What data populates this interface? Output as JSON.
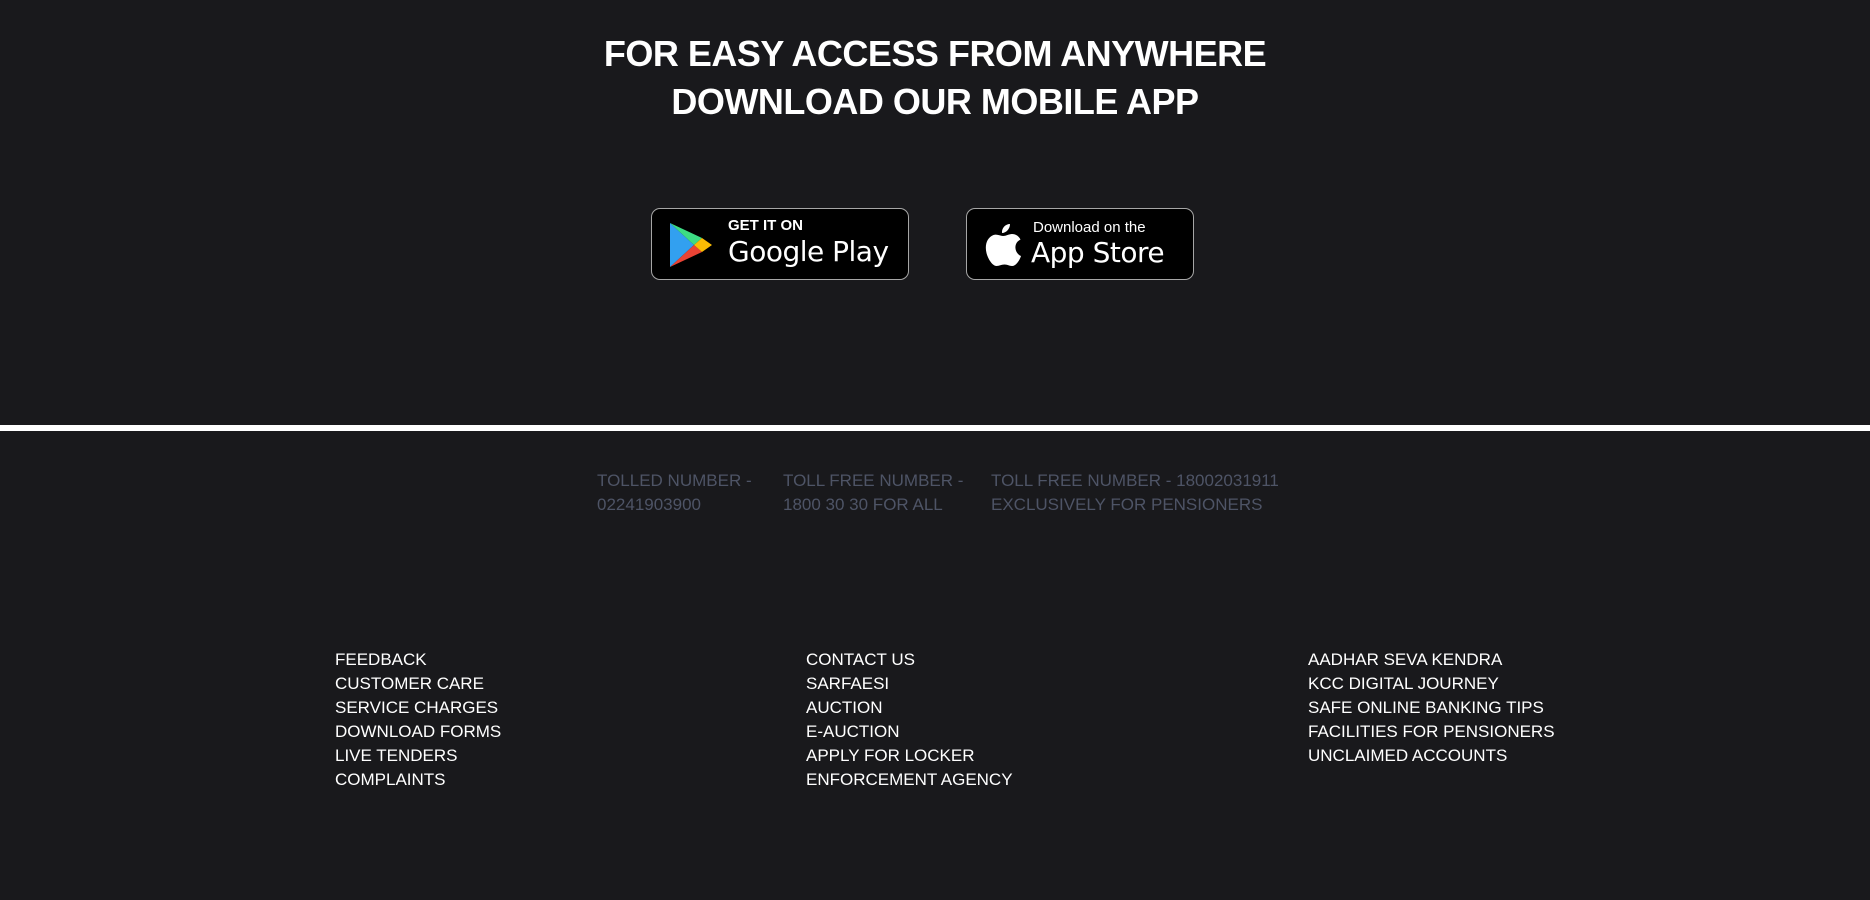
{
  "app_promo": {
    "heading_line1": "FOR EASY ACCESS FROM ANYWHERE",
    "heading_line2": "DOWNLOAD OUR MOBILE APP",
    "google_play": {
      "small": "GET IT ON",
      "big": "Google Play",
      "icon": "google-play-icon"
    },
    "app_store": {
      "small": "Download on the",
      "big": "App Store",
      "icon": "apple-icon"
    }
  },
  "contact_numbers": [
    {
      "line1": "TOLLED NUMBER -",
      "line2": "02241903900"
    },
    {
      "line1": "TOLL FREE NUMBER -",
      "line2": "1800 30 30 FOR ALL"
    },
    {
      "line1": "TOLL FREE NUMBER - 18002031911",
      "line2": "EXCLUSIVELY FOR PENSIONERS"
    }
  ],
  "footer_links": {
    "column1": [
      "FEEDBACK",
      "CUSTOMER CARE",
      "SERVICE CHARGES",
      "DOWNLOAD FORMS",
      "LIVE TENDERS",
      "COMPLAINTS"
    ],
    "column2": [
      "CONTACT US",
      "SARFAESI",
      "AUCTION",
      "E-AUCTION",
      "APPLY FOR LOCKER",
      "ENFORCEMENT AGENCY"
    ],
    "column3": [
      "AADHAR SEVA KENDRA",
      "KCC DIGITAL JOURNEY",
      "SAFE ONLINE BANKING TIPS",
      "FACILITIES FOR PENSIONERS",
      "UNCLAIMED ACCOUNTS"
    ]
  },
  "colors": {
    "background": "#19191c",
    "heading_text": "#ffffff",
    "phone_text": "#4e5466",
    "link_text": "#ffffff",
    "divider": "#ffffff"
  }
}
